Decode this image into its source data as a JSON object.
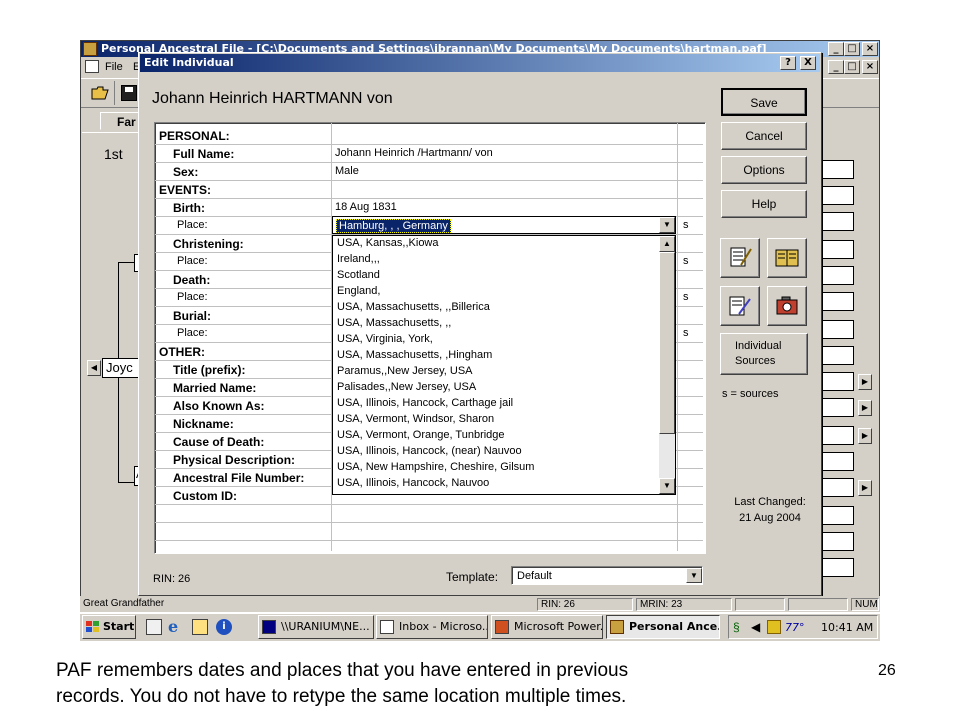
{
  "main_window": {
    "title": "Personal Ancestral File - [C:\\Documents and Settings\\jbrannan\\My Documents\\My Documents\\hartman.paf]",
    "menu_file": "File",
    "menu_edit": "E",
    "tab_label": "Far",
    "generation_label": "1st",
    "tree_person": "Joyc",
    "tree_letter_a": "A"
  },
  "dialog": {
    "title": "Edit Individual",
    "help_caption": "?",
    "close_caption": "X",
    "person_name": "Johann Heinrich HARTMANN von",
    "rin_label": "RIN: 26",
    "template_label": "Template:",
    "template_value": "Default",
    "buttons": {
      "save": "Save",
      "cancel": "Cancel",
      "options": "Options",
      "help": "Help",
      "individual_sources": "Individual Sources"
    },
    "sources_legend": "s = sources",
    "last_changed_label": "Last Changed:",
    "last_changed_date": "21 Aug 2004",
    "sections": {
      "personal": "PERSONAL:",
      "events": "EVENTS:",
      "other": "OTHER:"
    },
    "fields": {
      "full_name_label": "Full Name:",
      "full_name_value": "Johann Heinrich /Hartmann/ von",
      "sex_label": "Sex:",
      "sex_value": "Male",
      "birth_label": "Birth:",
      "birth_value": "18 Aug 1831",
      "birth_place_label": "Place:",
      "birth_place_value": "Hamburg, , , Germany",
      "christening_label": "Christening:",
      "christening_place_label": "Place:",
      "death_label": "Death:",
      "death_place_label": "Place:",
      "burial_label": "Burial:",
      "burial_place_label": "Place:",
      "title_label": "Title (prefix):",
      "married_name_label": "Married Name:",
      "aka_label": "Also Known As:",
      "nickname_label": "Nickname:",
      "cause_death_label": "Cause of Death:",
      "physical_label": "Physical Description:",
      "afn_label": "Ancestral File Number:",
      "custom_id_label": "Custom ID:",
      "s_marker": "s"
    },
    "place_dropdown": [
      "USA, Kansas,,Kiowa",
      "Ireland,,,",
      "Scotland",
      "England,",
      "USA, Massachusetts, ,,Billerica",
      "USA, Massachusetts, ,,",
      "USA, Virginia, York,",
      "USA, Massachusetts, ,Hingham",
      "Paramus,,New Jersey, USA",
      "Palisades,,New Jersey, USA",
      "USA, Illinois, Hancock, Carthage jail",
      "USA, Vermont, Windsor, Sharon",
      "USA, Vermont, Orange, Tunbridge",
      "USA, Illinois, Hancock, (near) Nauvoo",
      "USA, New Hampshire, Cheshire, Gilsum",
      "USA, Illinois, Hancock, Nauvoo"
    ]
  },
  "status_bar": {
    "left": "Great Grandfather",
    "rin": "RIN: 26",
    "mrin": "MRIN: 23",
    "num": "NUM"
  },
  "taskbar": {
    "start": "Start",
    "tasks": [
      "\\\\URANIUM\\NE...",
      "Inbox - Microso...",
      "Microsoft Power...",
      "Personal Ance..."
    ],
    "temperature": "77°",
    "clock": "10:41 AM"
  },
  "caption": {
    "text_line1": "PAF remembers dates and places that you have entered in previous",
    "text_line2": "records.  You do not have to retype the same location multiple times.",
    "slide_number": "26"
  },
  "colors": {
    "titlebar": "#0a246a",
    "dialog_face": "#d4d0c8",
    "selection": "#0a246a"
  }
}
